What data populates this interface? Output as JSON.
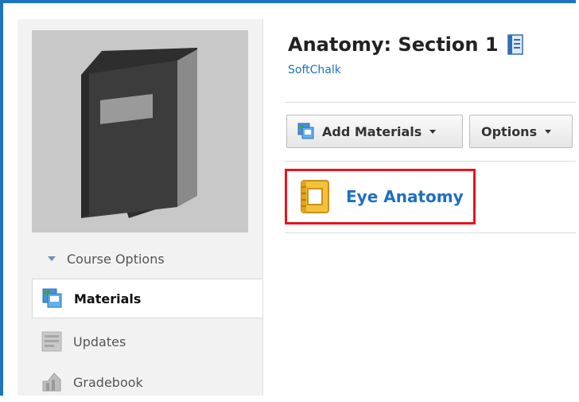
{
  "sidebar": {
    "course_options_label": "Course Options",
    "items": [
      {
        "label": "Materials",
        "icon": "materials-icon",
        "active": true
      },
      {
        "label": "Updates",
        "icon": "updates-icon",
        "active": false
      },
      {
        "label": "Gradebook",
        "icon": "gradebook-icon",
        "active": false
      }
    ]
  },
  "main": {
    "title": "Anatomy: Section 1",
    "title_icon": "notebook-icon",
    "org_link": "SoftChalk",
    "toolbar": {
      "add_materials_label": "Add Materials",
      "options_label": "Options"
    },
    "materials": [
      {
        "title": "Eye Anatomy",
        "icon": "lesson-icon",
        "highlighted": true
      }
    ]
  },
  "colors": {
    "frame_border": "#1f73bd",
    "link": "#1f73bd",
    "highlight": "#e8141e",
    "cover_bg": "#c8c8c8",
    "book": "#3c3c3c"
  }
}
